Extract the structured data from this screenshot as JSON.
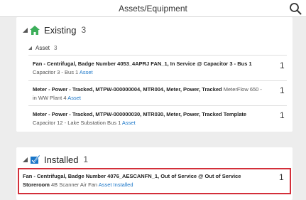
{
  "header": {
    "title": "Assets/Equipment",
    "search_icon": "search-icon"
  },
  "sections": {
    "existing": {
      "title": "Existing",
      "count": "3",
      "icon": "house-icon",
      "icon_color": "#3cae5a",
      "group": {
        "label": "Asset",
        "count": "3"
      },
      "rows": [
        {
          "title": "Fan - Centrifugal, Badge Number 4053_4APRJ FAN_1, In Service @ Capacitor 3 - Bus 1",
          "location": "Capacitor 3 - Bus 1",
          "link": "Asset",
          "qty": "1"
        },
        {
          "title": "Meter - Power - Tracked, MTPW-000000004, MTR004, Meter, Power, Tracked",
          "location": "MeterFlow 650 - in WW Plant 4",
          "link": "Asset",
          "qty": "1"
        },
        {
          "title": "Meter - Power - Tracked, MTPW-000000030, MTR030, Meter, Power, Tracked Template",
          "location": "Capacitor 12 - Lake Substation Bus 1",
          "link": "Asset",
          "qty": "1"
        }
      ]
    },
    "installed": {
      "title": "Installed",
      "count": "1",
      "icon": "installed-box-icon",
      "icon_color": "#1a76c8",
      "rows": [
        {
          "title": "Fan - Centrifugal, Badge Number 4076_AESCANFN_1, Out of Service @ Out of Service Storeroom",
          "location": "4B Scanner Air Fan",
          "link": "Asset Installed",
          "qty": "1"
        }
      ]
    }
  },
  "colors": {
    "highlight": "#d32f3a",
    "link": "#1a76c8"
  }
}
